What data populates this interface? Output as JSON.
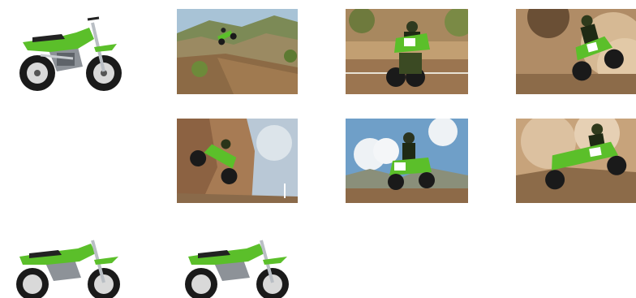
{
  "gallery": {
    "items": [
      {
        "id": "bike-studio-side-front",
        "kind": "studio",
        "facing": "right"
      },
      {
        "id": "action-hill-jump",
        "kind": "action",
        "scene": "hill"
      },
      {
        "id": "action-rider-front",
        "kind": "action",
        "scene": "dirt-front"
      },
      {
        "id": "action-rider-turn-dust",
        "kind": "action",
        "scene": "dust-turn"
      },
      {
        "id": "action-rider-whip-cliff",
        "kind": "action",
        "scene": "cliff-jump"
      },
      {
        "id": "action-rider-standing-sky",
        "kind": "action",
        "scene": "sky-rider"
      },
      {
        "id": "action-rider-berm-dust",
        "kind": "action",
        "scene": "berm-dust"
      },
      {
        "id": "bike-studio-side-a",
        "kind": "studio",
        "facing": "right"
      },
      {
        "id": "bike-studio-side-b",
        "kind": "studio",
        "facing": "right"
      }
    ]
  },
  "colors": {
    "kawasaki_green": "#5bbf2a",
    "dirt": "#8a6a4a",
    "sky": "#b8cde0",
    "tire": "#1a1a1a",
    "chrome": "#b9bec4"
  }
}
